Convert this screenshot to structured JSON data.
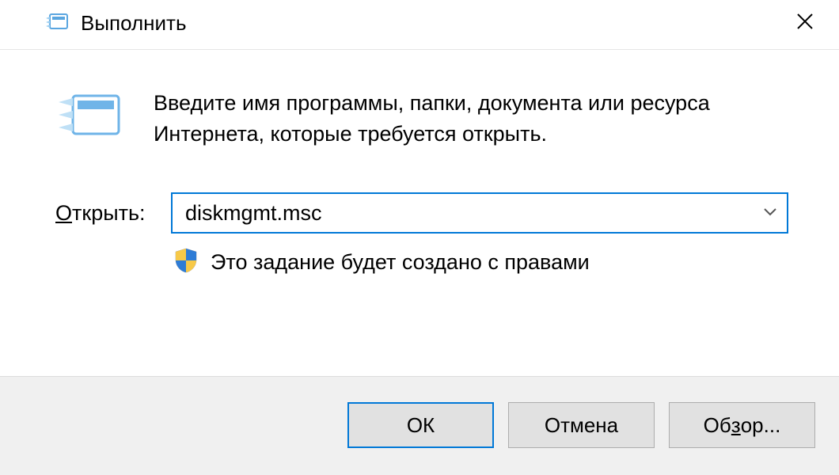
{
  "title": "Выполнить",
  "close_label": "✕",
  "description": "Введите имя программы, папки, документа или ресурса Интернета, которые требуется открыть.",
  "open_label_prefix": "О",
  "open_label_rest": "ткрыть:",
  "input_value": "diskmgmt.msc",
  "admin_note": "Это задание будет создано с правами",
  "buttons": {
    "ok": "ОК",
    "cancel": "Отмена",
    "browse_prefix": "Об",
    "browse_key": "з",
    "browse_rest": "ор..."
  }
}
